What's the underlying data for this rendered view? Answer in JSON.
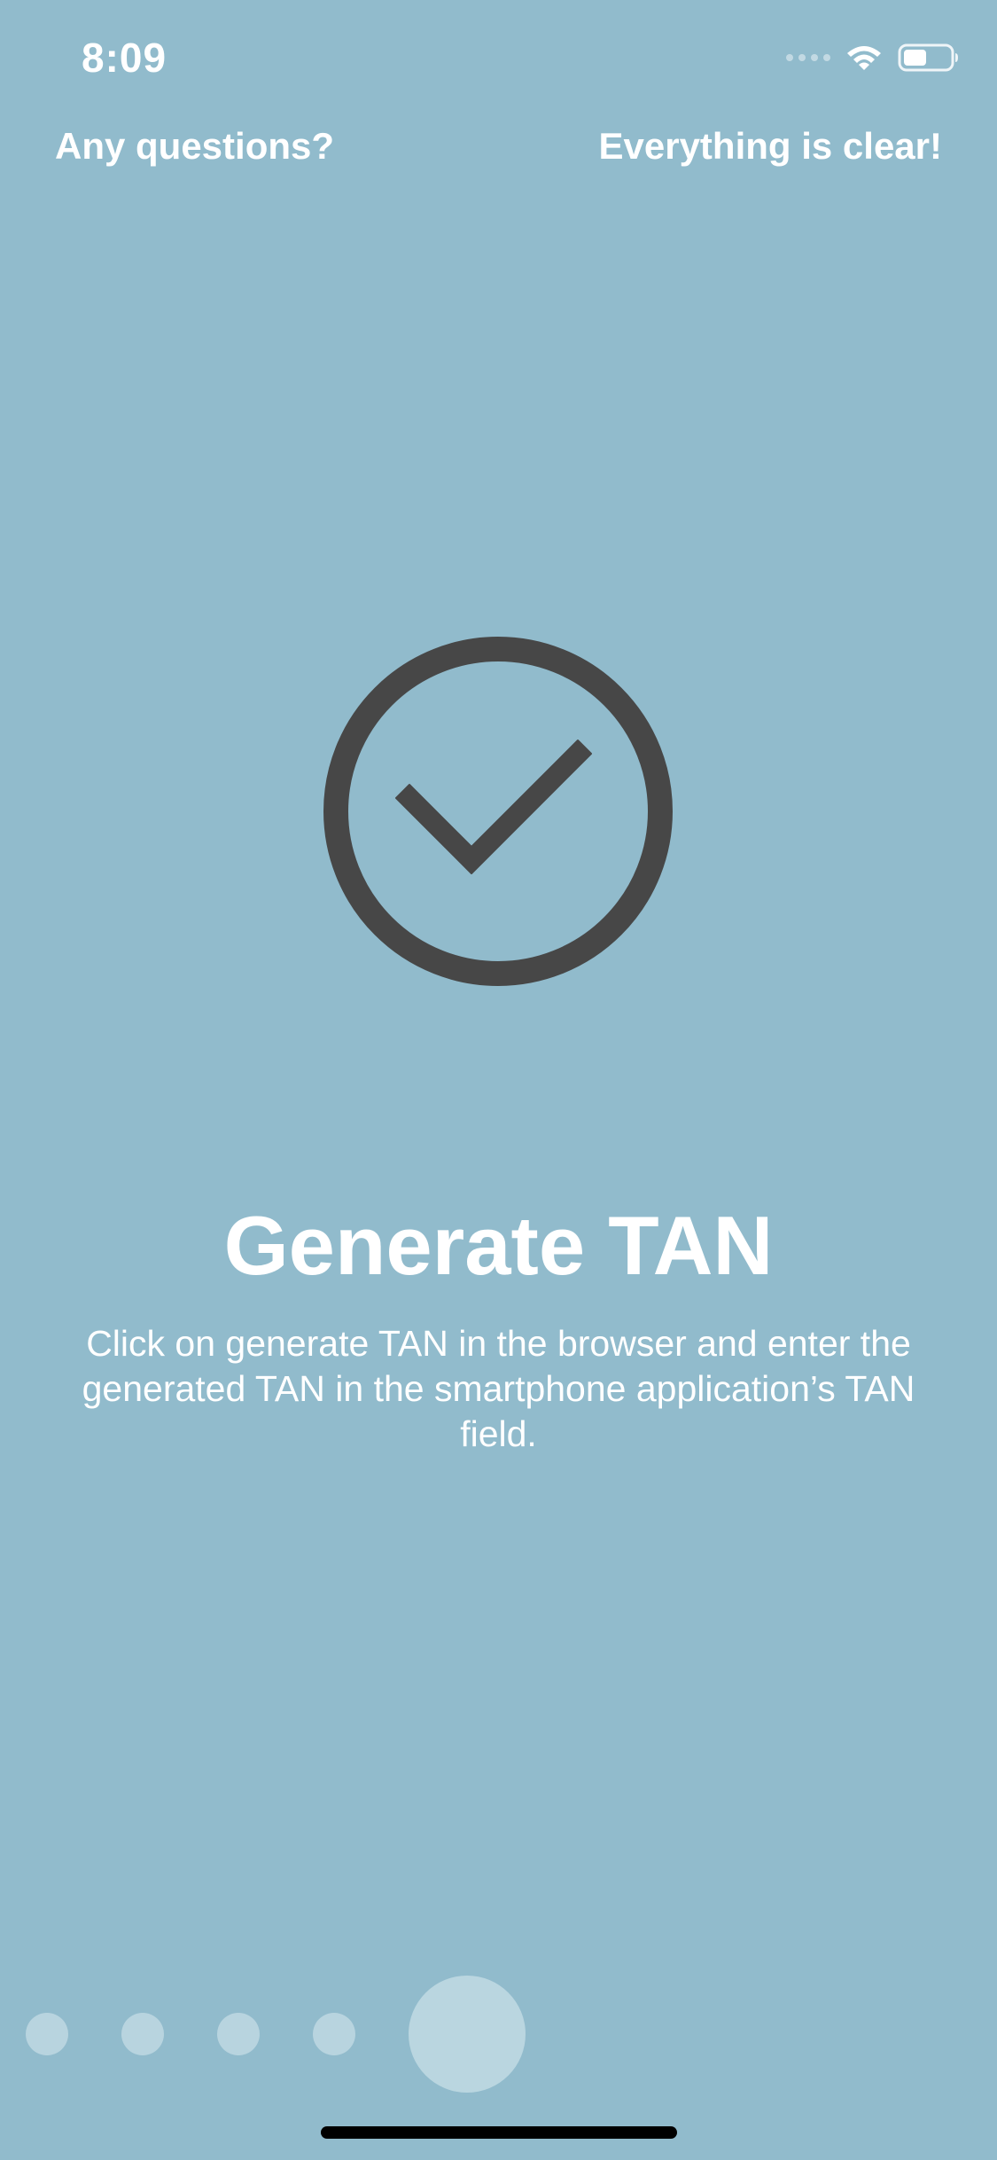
{
  "status_bar": {
    "time": "8:09",
    "wifi_icon": "wifi-icon",
    "battery_icon": "battery-icon",
    "signal_icon": "signal-icon"
  },
  "top_actions": {
    "left_label": "Any questions?",
    "right_label": "Everything is clear!"
  },
  "hero": {
    "icon": "checkmark-circle-icon",
    "icon_color": "#474747"
  },
  "content": {
    "title": "Generate TAN",
    "description": "Click on generate TAN in the browser and enter the generated TAN in the smartphone application’s TAN field."
  },
  "pager": {
    "current_page": 5,
    "total_pages": 5
  },
  "colors": {
    "background": "#91bbcc",
    "text": "#ffffff",
    "dot": "#b8d4df",
    "home_indicator": "#000000"
  }
}
